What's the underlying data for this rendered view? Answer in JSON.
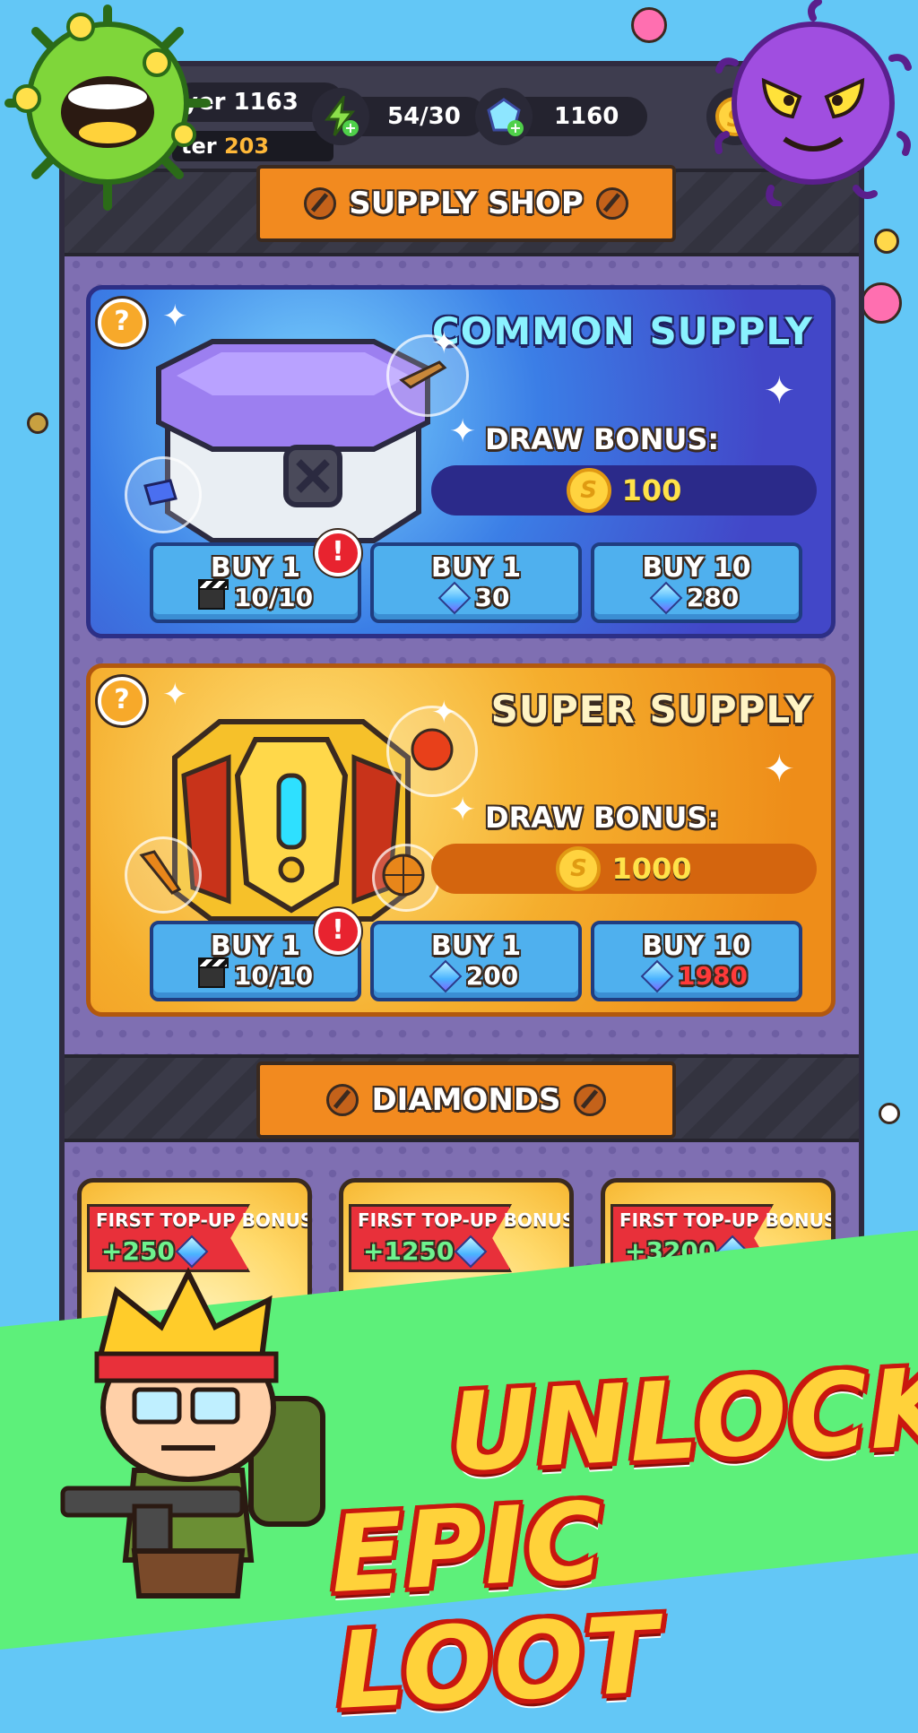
{
  "player": {
    "name_label": "yer 1163",
    "power_prefix": "ter",
    "power_value": "203"
  },
  "resources": {
    "energy": "54/30",
    "gems": "1160"
  },
  "icons": {
    "energy": "lightning-plus-icon",
    "gems": "gem-plus-icon",
    "coins": "gold-coin-icon",
    "help": "question-icon",
    "alert": "exclamation-icon",
    "ticket": "clapperboard-icon"
  },
  "supply_shop": {
    "title": "SUPPLY SHOP",
    "cards": [
      {
        "title": "COMMON SUPPLY",
        "help_label": "?",
        "draw_label": "DRAW BONUS:",
        "bonus": "100",
        "buttons": [
          {
            "label": "BUY 1",
            "cost": "10/10",
            "currency": "ticket",
            "alert": "!"
          },
          {
            "label": "BUY 1",
            "cost": "30",
            "currency": "gem"
          },
          {
            "label": "BUY 10",
            "cost": "280",
            "currency": "gem"
          }
        ]
      },
      {
        "title": "SUPER SUPPLY",
        "help_label": "?",
        "draw_label": "DRAW BONUS:",
        "bonus": "1000",
        "buttons": [
          {
            "label": "BUY 1",
            "cost": "10/10",
            "currency": "ticket",
            "alert": "!"
          },
          {
            "label": "BUY 1",
            "cost": "200",
            "currency": "gem"
          },
          {
            "label": "BUY 10",
            "cost": "1980",
            "currency": "gem",
            "cost_color": "#ff3a3a"
          }
        ]
      }
    ]
  },
  "diamonds": {
    "title": "DIAMONDS",
    "packs": [
      {
        "bonus_label": "FIRST TOP-UP BONUS",
        "amount": "+250"
      },
      {
        "bonus_label": "FIRST TOP-UP BONUS",
        "amount": "+1250"
      },
      {
        "bonus_label": "FIRST TOP-UP BONUS",
        "amount": "+3200"
      }
    ]
  },
  "slogan": {
    "line1": "UNLOCK",
    "line2": "EPIC LOOT"
  },
  "colors": {
    "background": "#63c7f6",
    "banner": "#f28a1f",
    "button": "#4fb0ee",
    "green": "#5df07a",
    "slogan_fill": "#ffd23a",
    "slogan_outline": "#c9170f"
  }
}
